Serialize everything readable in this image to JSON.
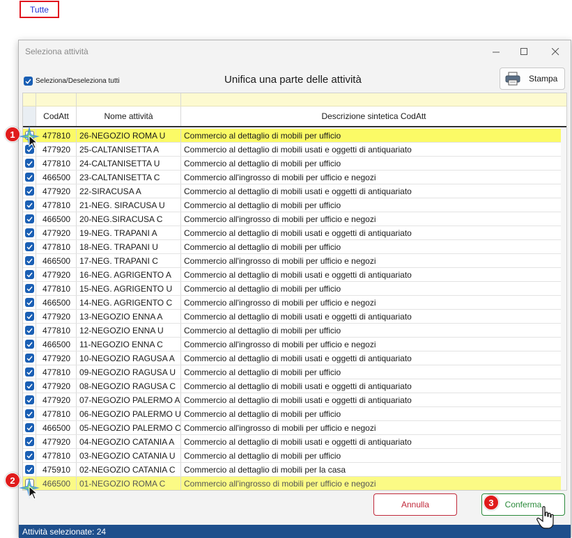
{
  "top_link": {
    "label": "Tutte"
  },
  "dialog": {
    "title": "Seleziona attività",
    "select_all_label": "Seleziona/Deseleziona tutti",
    "heading": "Unifica una parte delle attività",
    "print_label": "Stampa",
    "columns": [
      "CodAtt",
      "Nome attività",
      "Descrizione sintetica CodAtt"
    ],
    "rows": [
      {
        "checked": false,
        "code": "477810",
        "name": "26-NEGOZIO ROMA U",
        "desc": "Commercio al dettaglio di mobili per ufficio"
      },
      {
        "checked": true,
        "code": "477920",
        "name": "25-CALTANISETTA A",
        "desc": "Commercio al dettaglio di mobili usati e oggetti di antiquariato"
      },
      {
        "checked": true,
        "code": "477810",
        "name": "24-CALTANISETTA U",
        "desc": "Commercio al dettaglio di mobili per ufficio"
      },
      {
        "checked": true,
        "code": "466500",
        "name": "23-CALTANISETTA C",
        "desc": "Commercio all'ingrosso di mobili per ufficio e negozi"
      },
      {
        "checked": true,
        "code": "477920",
        "name": "22-SIRACUSA A",
        "desc": "Commercio al dettaglio di mobili usati e oggetti di antiquariato"
      },
      {
        "checked": true,
        "code": "477810",
        "name": "21-NEG. SIRACUSA U",
        "desc": "Commercio al dettaglio di mobili per ufficio"
      },
      {
        "checked": true,
        "code": "466500",
        "name": "20-NEG.SIRACUSA C",
        "desc": "Commercio all'ingrosso di mobili per ufficio e negozi"
      },
      {
        "checked": true,
        "code": "477920",
        "name": "19-NEG. TRAPANI A",
        "desc": "Commercio al dettaglio di mobili usati e oggetti di antiquariato"
      },
      {
        "checked": true,
        "code": "477810",
        "name": "18-NEG. TRAPANI U",
        "desc": "Commercio al dettaglio di mobili per ufficio"
      },
      {
        "checked": true,
        "code": "466500",
        "name": "17-NEG. TRAPANI C",
        "desc": "Commercio all'ingrosso di mobili per ufficio e negozi"
      },
      {
        "checked": true,
        "code": "477920",
        "name": "16-NEG. AGRIGENTO A",
        "desc": "Commercio al dettaglio di mobili usati e oggetti di antiquariato"
      },
      {
        "checked": true,
        "code": "477810",
        "name": "15-NEG. AGRIGENTO U",
        "desc": "Commercio al dettaglio di mobili per ufficio"
      },
      {
        "checked": true,
        "code": "466500",
        "name": "14-NEG. AGRIGENTO C",
        "desc": "Commercio all'ingrosso di mobili per ufficio e negozi"
      },
      {
        "checked": true,
        "code": "477920",
        "name": "13-NEGOZIO ENNA A",
        "desc": "Commercio al dettaglio di mobili usati e oggetti di antiquariato"
      },
      {
        "checked": true,
        "code": "477810",
        "name": "12-NEGOZIO ENNA U",
        "desc": "Commercio al dettaglio di mobili per ufficio"
      },
      {
        "checked": true,
        "code": "466500",
        "name": "11-NEGOZIO ENNA C",
        "desc": "Commercio all'ingrosso di mobili per ufficio e negozi"
      },
      {
        "checked": true,
        "code": "477920",
        "name": "10-NEGOZIO RAGUSA A",
        "desc": "Commercio al dettaglio di mobili usati e oggetti di antiquariato"
      },
      {
        "checked": true,
        "code": "477810",
        "name": "09-NEGOZIO RAGUSA U",
        "desc": "Commercio al dettaglio di mobili per ufficio"
      },
      {
        "checked": true,
        "code": "477920",
        "name": "08-NEGOZIO RAGUSA C",
        "desc": "Commercio al dettaglio di mobili usati e oggetti di antiquariato"
      },
      {
        "checked": true,
        "code": "477920",
        "name": "07-NEGOZIO PALERMO A",
        "desc": "Commercio al dettaglio di mobili usati e oggetti di antiquariato"
      },
      {
        "checked": true,
        "code": "477810",
        "name": "06-NEGOZIO PALERMO U",
        "desc": "Commercio al dettaglio di mobili per ufficio"
      },
      {
        "checked": true,
        "code": "466500",
        "name": "05-NEGOZIO PALERMO C",
        "desc": "Commercio all'ingrosso di mobili per ufficio e negozi"
      },
      {
        "checked": true,
        "code": "477920",
        "name": "04-NEGOZIO CATANIA A",
        "desc": "Commercio al dettaglio di mobili usati e oggetti di antiquariato"
      },
      {
        "checked": true,
        "code": "477810",
        "name": "03-NEGOZIO CATANIA U",
        "desc": "Commercio al dettaglio di mobili per ufficio"
      },
      {
        "checked": true,
        "code": "475910",
        "name": "02-NEGOZIO CATANIA C",
        "desc": "Commercio al dettaglio di mobili per la casa"
      },
      {
        "checked": false,
        "code": "466500",
        "name": "01-NEGOZIO ROMA C",
        "desc": "Commercio all'ingrosso di mobili per ufficio e negozi"
      }
    ],
    "cancel_label": "Annulla",
    "confirm_label": "Conferma",
    "status_text": "Attività selezionate: 24"
  },
  "markers": [
    "1",
    "2",
    "3"
  ],
  "colors": {
    "accent": "#1a5fb4",
    "highlight": "#fbfa66",
    "status_bar": "#1e4f8c",
    "cancel": "#c0283a",
    "confirm": "#2a8a3a",
    "marker": "#e01b1b"
  }
}
